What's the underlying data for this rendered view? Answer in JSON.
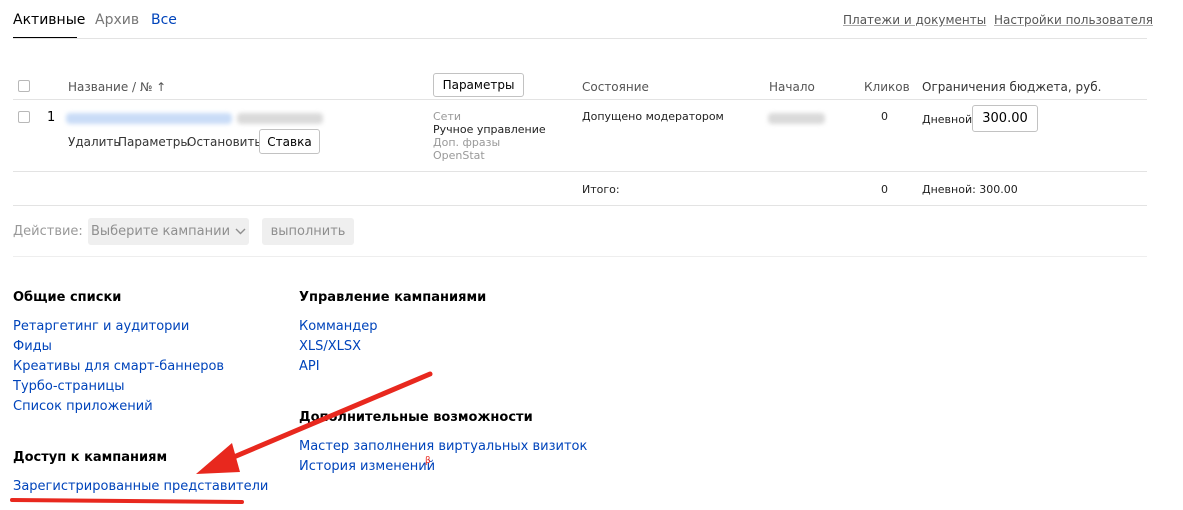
{
  "tabs": [
    {
      "label": "Активные",
      "active": true
    },
    {
      "label": "Архив",
      "active": false
    },
    {
      "label": "Все",
      "active": false
    }
  ],
  "top_links": {
    "payments": "Платежи и документы",
    "user_settings": "Настройки пользователя"
  },
  "table": {
    "params_button": "Параметры",
    "headers": {
      "name": "Название / № ↑",
      "status": "Состояние",
      "start": "Начало",
      "clicks": "Кликов",
      "budget": "Ограничения бюджета, руб."
    },
    "row": {
      "number": "1",
      "actions": {
        "delete": "Удалить",
        "params": "Параметры",
        "stop": "Остановить"
      },
      "bid_button": "Ставка",
      "info": [
        "Сети",
        "Ручное управление",
        "Доп. фразы",
        "OpenStat"
      ],
      "status": "Допущено модератором",
      "clicks": "0",
      "budget_label": "Дневной:",
      "budget_value": "300.00"
    },
    "total": {
      "label": "Итого:",
      "clicks": "0",
      "budget": "Дневной: 300.00"
    }
  },
  "action_bar": {
    "label": "Действие:",
    "select_placeholder": "Выберите кампании",
    "execute": "выполнить"
  },
  "sections": {
    "general": {
      "title": "Общие списки",
      "links": [
        "Ретаргетинг и аудитории",
        "Фиды",
        "Креативы для смарт-баннеров",
        "Турбо-страницы",
        "Список приложений"
      ]
    },
    "management": {
      "title": "Управление кампаниями",
      "links": [
        "Коммандер",
        "XLS/XLSX",
        "API"
      ]
    },
    "extra": {
      "title": "Дополнительные возможности",
      "links": [
        "Мастер заполнения виртуальных визиток",
        "История изменений"
      ],
      "beta_mark": "β"
    },
    "access": {
      "title": "Доступ к кампаниям",
      "links": [
        "Зарегистрированные представители"
      ]
    }
  },
  "colors": {
    "link": "#0044bb",
    "annotation": "#e8281e"
  }
}
